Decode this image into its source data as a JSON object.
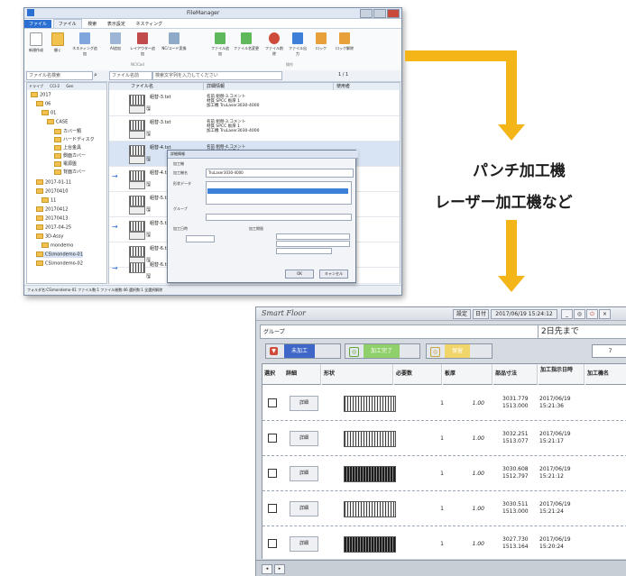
{
  "labels": {
    "line1": "パンチ加工機",
    "line2": "レーザー加工機など"
  },
  "filemanager": {
    "title": "FileManager",
    "menu": [
      "ファイル",
      "ファイル",
      "検索",
      "表示設定",
      "ネスティング"
    ],
    "ribbon": [
      "新規作成",
      "開く",
      "ネスティング追加",
      "AI追加",
      "レイアウター追加",
      "NC/コード変換",
      "ファイル追加",
      "ファイル名変更",
      "ファイル削除",
      "ファイル出力",
      "ロック",
      "ロック解除"
    ],
    "ribbon_groups": [
      "NC/Cad",
      "操作"
    ],
    "search_placeholder": "ファイル名検索",
    "filter_label": "ファイル名前",
    "filter_placeholder": "検索文字列を入力してください",
    "page_info": "1 / 1",
    "tree_tabs": [
      "ドライブ",
      "CCI-2",
      "Gen"
    ],
    "tree": [
      "2017",
      "06",
      "01",
      "CASE",
      "カバー類",
      "ハードディスク",
      "上台金具",
      "側面カバー",
      "電源盤",
      "背面カバー",
      "2017-01-11",
      "20170410",
      "11",
      "20170412",
      "20170413",
      "2017-04-25",
      "3D-Assy",
      "mondemo",
      "CS\\mondemo-01",
      "CS\\mondemo-02"
    ],
    "columns": [
      "ファイル名",
      "詳細情報",
      "使用者"
    ],
    "rows": [
      {
        "name": "組替-3.txt",
        "d1": "名前 組替-3.コメント",
        "d2": "材質 SPCC 板厚 1",
        "d3": "加工機 TruLaser3030-4000"
      },
      {
        "name": "組替-3.txt",
        "d1": "名前 組替-3.コメント",
        "d2": "材質 SPCC 板厚 1",
        "d3": "加工機 TruLaser3030-4000"
      },
      {
        "name": "組替-4.txt",
        "d1": "名前 組替-4.コメント",
        "d2": "材質 SPCC 板厚 1",
        "d3": "加工機 TruLaser3030-4000"
      },
      {
        "name": "組替-4.txt",
        "d1": "",
        "d2": "",
        "d3": ""
      },
      {
        "name": "組替-5.txt",
        "d1": "",
        "d2": "",
        "d3": ""
      },
      {
        "name": "組替-5.txt",
        "d1": "",
        "d2": "",
        "d3": ""
      },
      {
        "name": "組替-6.txt",
        "d1": "",
        "d2": "",
        "d3": ""
      },
      {
        "name": "組替-6.txt",
        "d1": "",
        "d2": "",
        "d3": ""
      }
    ],
    "status": "フォルダ名:CS\\mondemo-01 ファイル数:1 ファイル総数:46 選択数:1 全選択解除",
    "dialog": {
      "title": "詳細情報",
      "l1": "加工機",
      "l2": "加工機名",
      "v2": "TruLaser3030-4000",
      "l3": "形状データ",
      "l4": "グループ",
      "l5": "加工日時",
      "l6": "加工期限",
      "ok": "OK",
      "cancel": "キャンセル"
    }
  },
  "smartfloor": {
    "logo": "Smart Floor",
    "settings": "設定",
    "date_label": "日付",
    "datetime": "2017/06/19 15:24:12",
    "group_label": "グループ",
    "group_value": "2日先まで",
    "filters": [
      {
        "label": "未加工",
        "color": "#3f67c8",
        "icon": "▼"
      },
      {
        "label": "加工完了",
        "color": "#8fd06a",
        "icon": "◎"
      },
      {
        "label": "保留",
        "color": "#f0d66a",
        "icon": "◎"
      }
    ],
    "count": "7",
    "columns": [
      "選択",
      "詳細",
      "形状",
      "必要数",
      "板厚",
      "部品寸法",
      "加工指示日時",
      "加工機名"
    ],
    "rows": [
      {
        "detail": "詳細",
        "qty": "1",
        "thk": "1.00",
        "dim1": "3031.779",
        "dim2": "1513.000",
        "date": "2017/06/19",
        "time": "15:21:36",
        "dark": false
      },
      {
        "detail": "詳細",
        "qty": "1",
        "thk": "1.00",
        "dim1": "3032.251",
        "dim2": "1513.077",
        "date": "2017/06/19",
        "time": "15:21:17",
        "dark": false
      },
      {
        "detail": "詳細",
        "qty": "1",
        "thk": "1.00",
        "dim1": "3030.608",
        "dim2": "1512.797",
        "date": "2017/06/19",
        "time": "15:21:12",
        "dark": true
      },
      {
        "detail": "詳細",
        "qty": "1",
        "thk": "1.00",
        "dim1": "3030.511",
        "dim2": "1513.000",
        "date": "2017/06/19",
        "time": "15:21:24",
        "dark": false
      },
      {
        "detail": "詳細",
        "qty": "1",
        "thk": "1.00",
        "dim1": "3027.730",
        "dim2": "1513.164",
        "date": "2017/06/19",
        "time": "15:20:24",
        "dark": true
      }
    ]
  }
}
